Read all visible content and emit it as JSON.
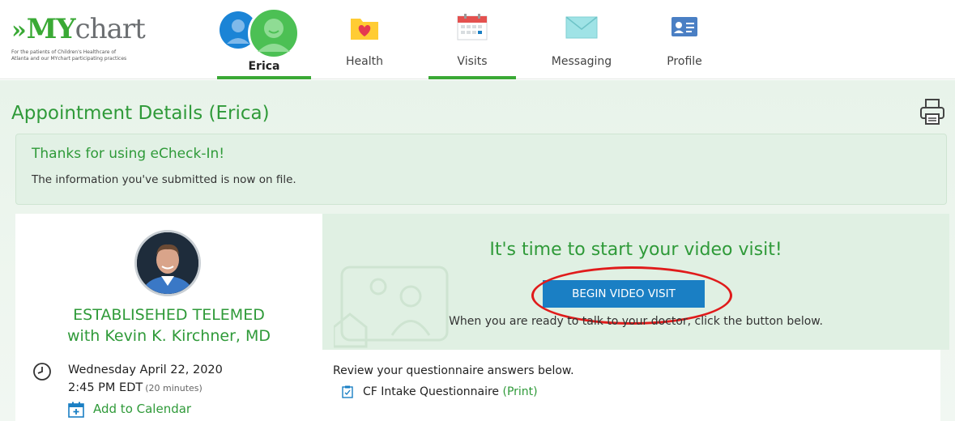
{
  "logo": {
    "arrows": "»",
    "brand_my": "MY",
    "brand_chart": "chart",
    "tagline_1": "For the patients of Children's Healthcare of",
    "tagline_2": "Atlanta and our MYchart participating practices"
  },
  "nav": {
    "patient_name": "Erica",
    "health": "Health",
    "visits": "Visits",
    "messaging": "Messaging",
    "profile": "Profile",
    "active": "Visits",
    "accent": "#3aa935"
  },
  "page": {
    "title": "Appointment Details",
    "patient": "(Erica)"
  },
  "banner": {
    "title": "Thanks for using eCheck-In!",
    "text": "The information you've submitted is now on file."
  },
  "visit": {
    "type": "ESTABLISEHED TELEMED",
    "provider": "with Kevin K. Kirchner, MD",
    "date": "Wednesday April 22, 2020",
    "time": "2:45 PM EDT",
    "duration": "(20 minutes)",
    "add_to_calendar": "Add to Calendar"
  },
  "video": {
    "heading": "It's time to start your video visit!",
    "button": "BEGIN VIDEO VISIT",
    "subtext": "When you are ready to talk to your doctor, click the button below.",
    "button_color": "#1a7fc4",
    "highlight_color": "#e01b1b"
  },
  "questionnaire": {
    "intro": "Review your questionnaire answers below.",
    "name": "CF Intake Questionnaire",
    "print": "(Print)"
  },
  "icons": {
    "print": "printer-icon",
    "clock": "clock-icon",
    "calendar": "calendar-add-icon",
    "questionnaire": "clipboard-icon"
  }
}
